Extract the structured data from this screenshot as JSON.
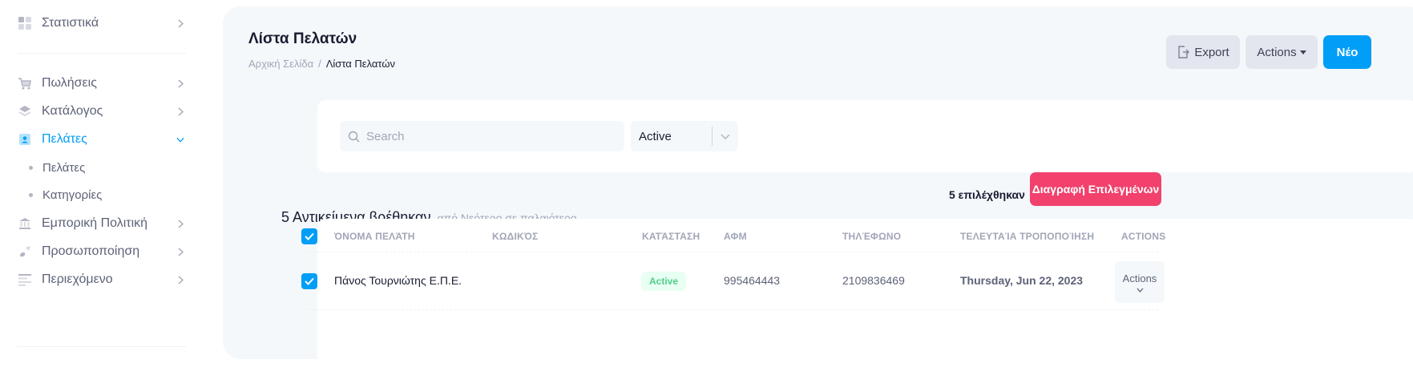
{
  "sidebar": {
    "items": [
      {
        "label": "Στατιστικά",
        "icon": "dashboard-icon"
      },
      {
        "label": "Πωλήσεις",
        "icon": "cart-icon"
      },
      {
        "label": "Κατάλογος",
        "icon": "layers-icon"
      },
      {
        "label": "Πελάτες",
        "icon": "contact-card-icon"
      },
      {
        "label": "Εμπορική Πολιτική",
        "icon": "bank-icon"
      },
      {
        "label": "Προσωποποίηση",
        "icon": "brush-icon"
      },
      {
        "label": "Περιεχόμενο",
        "icon": "text-lines-icon"
      }
    ],
    "sub_items": [
      {
        "label": "Πελάτες"
      },
      {
        "label": "Κατηγορίες"
      }
    ]
  },
  "header": {
    "title": "Λίστα Πελατών",
    "breadcrumb": {
      "home": "Αρχική Σελίδα",
      "separator": "/",
      "current": "Λίστα Πελατών"
    },
    "export_label": "Export",
    "actions_label": "Actions",
    "new_label": "Νέο"
  },
  "filters": {
    "search_placeholder": "Search",
    "status_value": "Active"
  },
  "summary": {
    "count_text": "5 Αντικείμενα βρέθηκαν",
    "sort_text": "από Νεότερο σε παλαιότερο",
    "selected_text": "5  επιλέχθηκαν",
    "delete_label": "Διαγραφή Επιλεγμένων"
  },
  "table": {
    "columns": [
      "ΌΝΟΜΑ ΠΕΛΆΤΗ",
      "ΚΩΔΙΚΌΣ",
      "ΚΑΤΆΣΤΑΣΗ",
      "ΑΦΜ",
      "ΤΗΛΈΦΩΝΟ",
      "ΤΕΛΕΥΤΑΊΑ ΤΡΟΠΟΠΟΊΗΣΗ",
      "ACTIONS"
    ],
    "rows": [
      {
        "name": "Πάνος Τουρνιώτης Ε.Π.Ε.",
        "code": "",
        "status": "Active",
        "vat": "995464443",
        "phone": "2109836469",
        "modified": "Thursday, Jun 22, 2023",
        "actions": "Actions"
      }
    ]
  },
  "colors": {
    "primary": "#009ef7",
    "danger": "#f1416c",
    "success": "#50cd89"
  }
}
